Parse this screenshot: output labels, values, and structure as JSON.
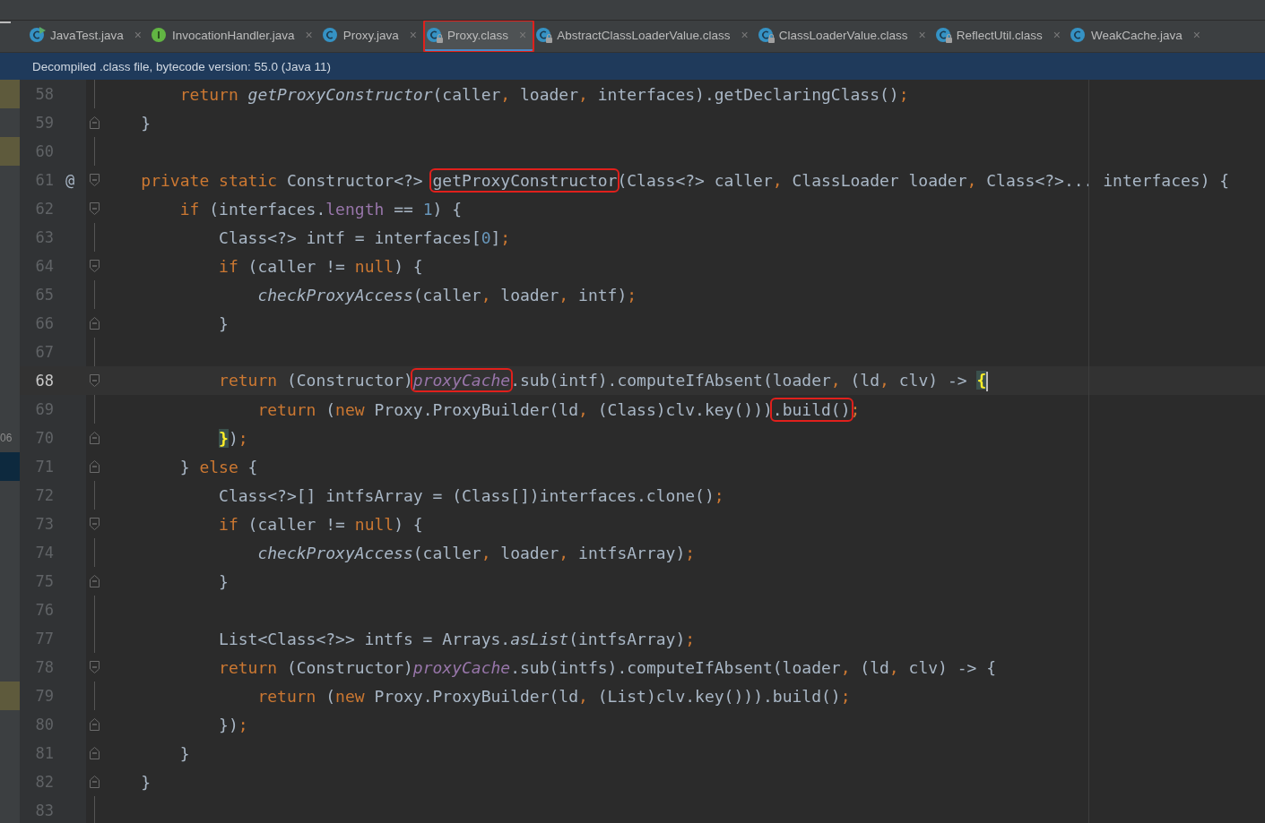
{
  "tabs": [
    {
      "label": "JavaTest.java",
      "kind": "class",
      "runnable": true,
      "locked": false,
      "close": "×",
      "selected": false,
      "highlighted": false
    },
    {
      "label": "InvocationHandler.java",
      "kind": "interface",
      "runnable": false,
      "locked": false,
      "close": "×",
      "selected": false,
      "highlighted": false
    },
    {
      "label": "Proxy.java",
      "kind": "class",
      "runnable": false,
      "locked": false,
      "close": "×",
      "selected": false,
      "highlighted": false
    },
    {
      "label": "Proxy.class",
      "kind": "class",
      "runnable": false,
      "locked": true,
      "close": "×",
      "selected": true,
      "highlighted": true
    },
    {
      "label": "AbstractClassLoaderValue.class",
      "kind": "class",
      "runnable": false,
      "locked": true,
      "close": "×",
      "selected": false,
      "highlighted": false
    },
    {
      "label": "ClassLoaderValue.class",
      "kind": "class",
      "runnable": false,
      "locked": true,
      "close": "×",
      "selected": false,
      "highlighted": false
    },
    {
      "label": "ReflectUtil.class",
      "kind": "class",
      "runnable": false,
      "locked": true,
      "close": "×",
      "selected": false,
      "highlighted": false
    },
    {
      "label": "WeakCache.java",
      "kind": "class",
      "runnable": false,
      "locked": false,
      "close": "×",
      "selected": false,
      "highlighted": false
    }
  ],
  "banner": "Decompiled .class file, bytecode version: 55.0 (Java 11)",
  "editor": {
    "lines": [
      {
        "number": "58",
        "changed": true,
        "selected": false,
        "fold_start": false,
        "fold_end": false,
        "current": false,
        "segments": [
          {
            "kind": "kw",
            "t": "        return "
          },
          {
            "kind": "it",
            "t": "getProxyConstructor"
          },
          {
            "kind": "id",
            "t": "(caller"
          },
          {
            "kind": "p",
            "t": ","
          },
          {
            "kind": "id",
            "t": " loader"
          },
          {
            "kind": "p",
            "t": ","
          },
          {
            "kind": "id",
            "t": " interfaces).getDeclaringClass()"
          },
          {
            "kind": "p",
            "t": ";"
          }
        ]
      },
      {
        "number": "59",
        "changed": false,
        "selected": false,
        "fold_start": false,
        "fold_end": true,
        "current": false,
        "segments": [
          {
            "kind": "id",
            "t": "    }"
          }
        ]
      },
      {
        "number": "60",
        "changed": true,
        "selected": false,
        "fold_start": false,
        "fold_end": false,
        "current": false
      },
      {
        "number": "61",
        "changed": false,
        "selected": false,
        "fold_start": true,
        "fold_end": false,
        "current": false,
        "mark": "@",
        "segments": [
          {
            "kind": "kw",
            "t": "    private static "
          },
          {
            "kind": "id",
            "t": "Constructor<?> "
          },
          {
            "kind": "id",
            "t": "getProxyConstructor",
            "boxed": true
          },
          {
            "kind": "id",
            "t": "(Class<?> caller"
          },
          {
            "kind": "p",
            "t": ","
          },
          {
            "kind": "id",
            "t": " ClassLoader loader"
          },
          {
            "kind": "p",
            "t": ","
          },
          {
            "kind": "id",
            "t": " Class<?>... interfaces) {"
          }
        ]
      },
      {
        "number": "62",
        "changed": false,
        "selected": false,
        "fold_start": true,
        "fold_end": false,
        "current": false,
        "segments": [
          {
            "kind": "kw",
            "t": "        if"
          },
          {
            "kind": "id",
            "t": " (interfaces."
          },
          {
            "kind": "fld",
            "t": "length"
          },
          {
            "kind": "id",
            "t": " == "
          },
          {
            "kind": "num",
            "t": "1"
          },
          {
            "kind": "id",
            "t": ") {"
          }
        ]
      },
      {
        "number": "63",
        "changed": false,
        "selected": false,
        "fold_start": false,
        "fold_end": false,
        "current": false,
        "segments": [
          {
            "kind": "id",
            "t": "            Class<?> intf = interfaces["
          },
          {
            "kind": "num",
            "t": "0"
          },
          {
            "kind": "id",
            "t": "]"
          },
          {
            "kind": "p",
            "t": ";"
          }
        ]
      },
      {
        "number": "64",
        "changed": false,
        "selected": false,
        "fold_start": true,
        "fold_end": false,
        "current": false,
        "segments": [
          {
            "kind": "kw",
            "t": "            if"
          },
          {
            "kind": "id",
            "t": " (caller != "
          },
          {
            "kind": "kw",
            "t": "null"
          },
          {
            "kind": "id",
            "t": ") {"
          }
        ]
      },
      {
        "number": "65",
        "changed": false,
        "selected": false,
        "fold_start": false,
        "fold_end": false,
        "current": false,
        "segments": [
          {
            "kind": "it",
            "t": "                checkProxyAccess"
          },
          {
            "kind": "id",
            "t": "(caller"
          },
          {
            "kind": "p",
            "t": ","
          },
          {
            "kind": "id",
            "t": " loader"
          },
          {
            "kind": "p",
            "t": ","
          },
          {
            "kind": "id",
            "t": " intf)"
          },
          {
            "kind": "p",
            "t": ";"
          }
        ]
      },
      {
        "number": "66",
        "changed": false,
        "selected": false,
        "fold_start": false,
        "fold_end": true,
        "current": false,
        "segments": [
          {
            "kind": "id",
            "t": "            }"
          }
        ]
      },
      {
        "number": "67",
        "changed": false,
        "selected": false,
        "fold_start": false,
        "fold_end": false,
        "current": false
      },
      {
        "number": "68",
        "changed": false,
        "selected": false,
        "fold_start": true,
        "fold_end": false,
        "current": true,
        "segments": [
          {
            "kind": "kw",
            "t": "            return"
          },
          {
            "kind": "id",
            "t": " (Constructor)"
          },
          {
            "kind": "fldi",
            "t": "proxyCache",
            "boxed": true
          },
          {
            "kind": "id",
            "t": ".sub(intf).computeIfAbsent(loader"
          },
          {
            "kind": "p",
            "t": ","
          },
          {
            "kind": "id",
            "t": " (ld"
          },
          {
            "kind": "p",
            "t": ","
          },
          {
            "kind": "id",
            "t": " clv) -> "
          },
          {
            "kind": "br",
            "t": "{",
            "caret": true
          }
        ]
      },
      {
        "number": "69",
        "changed": false,
        "selected": false,
        "fold_start": false,
        "fold_end": false,
        "current": false,
        "segments": [
          {
            "kind": "kw",
            "t": "                return"
          },
          {
            "kind": "id",
            "t": " ("
          },
          {
            "kind": "kw",
            "t": "new"
          },
          {
            "kind": "id",
            "t": " Proxy.ProxyBuilder(ld"
          },
          {
            "kind": "p",
            "t": ","
          },
          {
            "kind": "id",
            "t": " (Class)clv.key()))"
          },
          {
            "kind": "id",
            "t": ".build()",
            "boxed": true
          },
          {
            "kind": "p",
            "t": ";"
          }
        ]
      },
      {
        "number": "70",
        "changed": false,
        "selected": false,
        "side_text": "06",
        "fold_start": false,
        "fold_end": true,
        "current": false,
        "segments": [
          {
            "kind": "br",
            "t": "            }"
          },
          {
            "kind": "id",
            "t": ")"
          },
          {
            "kind": "p",
            "t": ";"
          }
        ]
      },
      {
        "number": "71",
        "changed": false,
        "selected": true,
        "fold_start": false,
        "fold_end": true,
        "current": false,
        "segments": [
          {
            "kind": "id",
            "t": "        } "
          },
          {
            "kind": "kw",
            "t": "else"
          },
          {
            "kind": "id",
            "t": " {"
          }
        ]
      },
      {
        "number": "72",
        "changed": false,
        "selected": false,
        "fold_start": false,
        "fold_end": false,
        "current": false,
        "segments": [
          {
            "kind": "id",
            "t": "            Class<?>[] intfsArray = (Class[])interfaces.clone()"
          },
          {
            "kind": "p",
            "t": ";"
          }
        ]
      },
      {
        "number": "73",
        "changed": false,
        "selected": false,
        "fold_start": true,
        "fold_end": false,
        "current": false,
        "segments": [
          {
            "kind": "kw",
            "t": "            if"
          },
          {
            "kind": "id",
            "t": " (caller != "
          },
          {
            "kind": "kw",
            "t": "null"
          },
          {
            "kind": "id",
            "t": ") {"
          }
        ]
      },
      {
        "number": "74",
        "changed": false,
        "selected": false,
        "fold_start": false,
        "fold_end": false,
        "current": false,
        "segments": [
          {
            "kind": "it",
            "t": "                checkProxyAccess"
          },
          {
            "kind": "id",
            "t": "(caller"
          },
          {
            "kind": "p",
            "t": ","
          },
          {
            "kind": "id",
            "t": " loader"
          },
          {
            "kind": "p",
            "t": ","
          },
          {
            "kind": "id",
            "t": " intfsArray)"
          },
          {
            "kind": "p",
            "t": ";"
          }
        ]
      },
      {
        "number": "75",
        "changed": false,
        "selected": false,
        "fold_start": false,
        "fold_end": true,
        "current": false,
        "segments": [
          {
            "kind": "id",
            "t": "            }"
          }
        ]
      },
      {
        "number": "76",
        "changed": false,
        "selected": false,
        "fold_start": false,
        "fold_end": false,
        "current": false
      },
      {
        "number": "77",
        "changed": false,
        "selected": false,
        "fold_start": false,
        "fold_end": false,
        "current": false,
        "segments": [
          {
            "kind": "id",
            "t": "            List<Class<?>> intfs = Arrays."
          },
          {
            "kind": "it",
            "t": "asList"
          },
          {
            "kind": "id",
            "t": "(intfsArray)"
          },
          {
            "kind": "p",
            "t": ";"
          }
        ]
      },
      {
        "number": "78",
        "changed": false,
        "selected": false,
        "fold_start": true,
        "fold_end": false,
        "current": false,
        "segments": [
          {
            "kind": "kw",
            "t": "            return"
          },
          {
            "kind": "id",
            "t": " (Constructor)"
          },
          {
            "kind": "fldi",
            "t": "proxyCache"
          },
          {
            "kind": "id",
            "t": ".sub(intfs).computeIfAbsent(loader"
          },
          {
            "kind": "p",
            "t": ","
          },
          {
            "kind": "id",
            "t": " (ld"
          },
          {
            "kind": "p",
            "t": ","
          },
          {
            "kind": "id",
            "t": " clv) -> {"
          }
        ]
      },
      {
        "number": "79",
        "changed": true,
        "selected": false,
        "fold_start": false,
        "fold_end": false,
        "current": false,
        "segments": [
          {
            "kind": "kw",
            "t": "                return"
          },
          {
            "kind": "id",
            "t": " ("
          },
          {
            "kind": "kw",
            "t": "new"
          },
          {
            "kind": "id",
            "t": " Proxy.ProxyBuilder(ld"
          },
          {
            "kind": "p",
            "t": ","
          },
          {
            "kind": "id",
            "t": " (List)clv.key())).build()"
          },
          {
            "kind": "p",
            "t": ";"
          }
        ]
      },
      {
        "number": "80",
        "changed": false,
        "selected": false,
        "fold_start": false,
        "fold_end": true,
        "current": false,
        "segments": [
          {
            "kind": "id",
            "t": "            })"
          },
          {
            "kind": "p",
            "t": ";"
          }
        ]
      },
      {
        "number": "81",
        "changed": false,
        "selected": false,
        "fold_start": false,
        "fold_end": true,
        "current": false,
        "segments": [
          {
            "kind": "id",
            "t": "        }"
          }
        ]
      },
      {
        "number": "82",
        "changed": false,
        "selected": false,
        "fold_start": false,
        "fold_end": true,
        "current": false,
        "segments": [
          {
            "kind": "id",
            "t": "    }"
          }
        ]
      },
      {
        "number": "83",
        "changed": false,
        "selected": false,
        "fold_start": false,
        "fold_end": false,
        "current": false
      }
    ]
  }
}
